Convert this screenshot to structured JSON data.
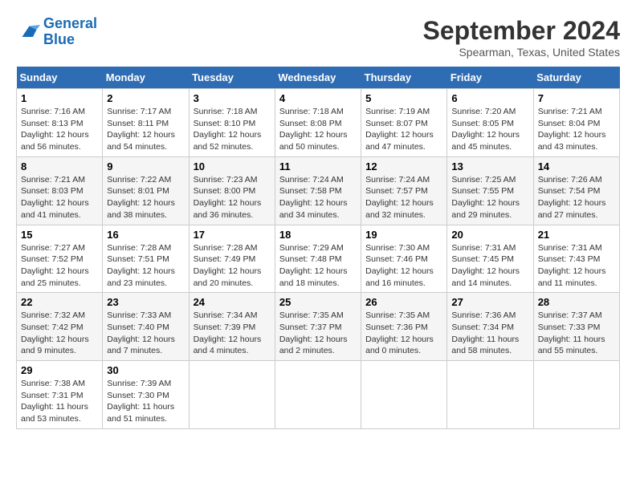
{
  "header": {
    "logo_line1": "General",
    "logo_line2": "Blue",
    "month_title": "September 2024",
    "location": "Spearman, Texas, United States"
  },
  "days_of_week": [
    "Sunday",
    "Monday",
    "Tuesday",
    "Wednesday",
    "Thursday",
    "Friday",
    "Saturday"
  ],
  "weeks": [
    [
      {
        "day": "1",
        "info": "Sunrise: 7:16 AM\nSunset: 8:13 PM\nDaylight: 12 hours\nand 56 minutes."
      },
      {
        "day": "2",
        "info": "Sunrise: 7:17 AM\nSunset: 8:11 PM\nDaylight: 12 hours\nand 54 minutes."
      },
      {
        "day": "3",
        "info": "Sunrise: 7:18 AM\nSunset: 8:10 PM\nDaylight: 12 hours\nand 52 minutes."
      },
      {
        "day": "4",
        "info": "Sunrise: 7:18 AM\nSunset: 8:08 PM\nDaylight: 12 hours\nand 50 minutes."
      },
      {
        "day": "5",
        "info": "Sunrise: 7:19 AM\nSunset: 8:07 PM\nDaylight: 12 hours\nand 47 minutes."
      },
      {
        "day": "6",
        "info": "Sunrise: 7:20 AM\nSunset: 8:05 PM\nDaylight: 12 hours\nand 45 minutes."
      },
      {
        "day": "7",
        "info": "Sunrise: 7:21 AM\nSunset: 8:04 PM\nDaylight: 12 hours\nand 43 minutes."
      }
    ],
    [
      {
        "day": "8",
        "info": "Sunrise: 7:21 AM\nSunset: 8:03 PM\nDaylight: 12 hours\nand 41 minutes."
      },
      {
        "day": "9",
        "info": "Sunrise: 7:22 AM\nSunset: 8:01 PM\nDaylight: 12 hours\nand 38 minutes."
      },
      {
        "day": "10",
        "info": "Sunrise: 7:23 AM\nSunset: 8:00 PM\nDaylight: 12 hours\nand 36 minutes."
      },
      {
        "day": "11",
        "info": "Sunrise: 7:24 AM\nSunset: 7:58 PM\nDaylight: 12 hours\nand 34 minutes."
      },
      {
        "day": "12",
        "info": "Sunrise: 7:24 AM\nSunset: 7:57 PM\nDaylight: 12 hours\nand 32 minutes."
      },
      {
        "day": "13",
        "info": "Sunrise: 7:25 AM\nSunset: 7:55 PM\nDaylight: 12 hours\nand 29 minutes."
      },
      {
        "day": "14",
        "info": "Sunrise: 7:26 AM\nSunset: 7:54 PM\nDaylight: 12 hours\nand 27 minutes."
      }
    ],
    [
      {
        "day": "15",
        "info": "Sunrise: 7:27 AM\nSunset: 7:52 PM\nDaylight: 12 hours\nand 25 minutes."
      },
      {
        "day": "16",
        "info": "Sunrise: 7:28 AM\nSunset: 7:51 PM\nDaylight: 12 hours\nand 23 minutes."
      },
      {
        "day": "17",
        "info": "Sunrise: 7:28 AM\nSunset: 7:49 PM\nDaylight: 12 hours\nand 20 minutes."
      },
      {
        "day": "18",
        "info": "Sunrise: 7:29 AM\nSunset: 7:48 PM\nDaylight: 12 hours\nand 18 minutes."
      },
      {
        "day": "19",
        "info": "Sunrise: 7:30 AM\nSunset: 7:46 PM\nDaylight: 12 hours\nand 16 minutes."
      },
      {
        "day": "20",
        "info": "Sunrise: 7:31 AM\nSunset: 7:45 PM\nDaylight: 12 hours\nand 14 minutes."
      },
      {
        "day": "21",
        "info": "Sunrise: 7:31 AM\nSunset: 7:43 PM\nDaylight: 12 hours\nand 11 minutes."
      }
    ],
    [
      {
        "day": "22",
        "info": "Sunrise: 7:32 AM\nSunset: 7:42 PM\nDaylight: 12 hours\nand 9 minutes."
      },
      {
        "day": "23",
        "info": "Sunrise: 7:33 AM\nSunset: 7:40 PM\nDaylight: 12 hours\nand 7 minutes."
      },
      {
        "day": "24",
        "info": "Sunrise: 7:34 AM\nSunset: 7:39 PM\nDaylight: 12 hours\nand 4 minutes."
      },
      {
        "day": "25",
        "info": "Sunrise: 7:35 AM\nSunset: 7:37 PM\nDaylight: 12 hours\nand 2 minutes."
      },
      {
        "day": "26",
        "info": "Sunrise: 7:35 AM\nSunset: 7:36 PM\nDaylight: 12 hours\nand 0 minutes."
      },
      {
        "day": "27",
        "info": "Sunrise: 7:36 AM\nSunset: 7:34 PM\nDaylight: 11 hours\nand 58 minutes."
      },
      {
        "day": "28",
        "info": "Sunrise: 7:37 AM\nSunset: 7:33 PM\nDaylight: 11 hours\nand 55 minutes."
      }
    ],
    [
      {
        "day": "29",
        "info": "Sunrise: 7:38 AM\nSunset: 7:31 PM\nDaylight: 11 hours\nand 53 minutes."
      },
      {
        "day": "30",
        "info": "Sunrise: 7:39 AM\nSunset: 7:30 PM\nDaylight: 11 hours\nand 51 minutes."
      },
      null,
      null,
      null,
      null,
      null
    ]
  ]
}
